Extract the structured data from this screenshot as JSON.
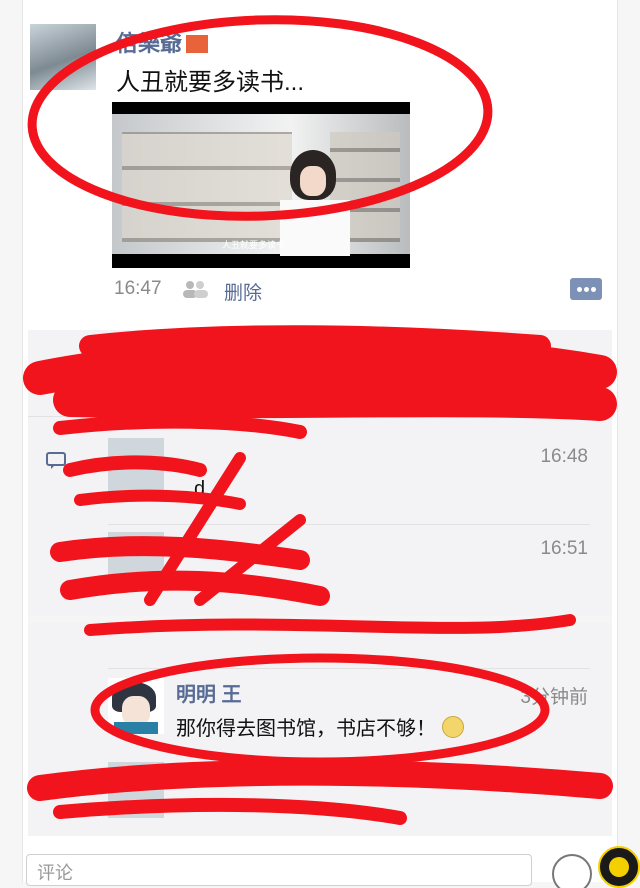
{
  "post": {
    "author": "倍樂爺",
    "text": "人丑就要多读书...",
    "time": "16:47",
    "delete_label": "删除",
    "video_subtitle": "人丑就要多读书"
  },
  "comments": [
    {
      "name": "",
      "text": "d",
      "time": "16:48"
    },
    {
      "name": "",
      "text": "",
      "time": "16:51"
    },
    {
      "name": "明明 王",
      "text": "那你得去图书馆，书店不够！",
      "time": "3分钟前"
    }
  ],
  "comment_input": {
    "placeholder": "评论"
  },
  "icons": [
    "people-icon",
    "more-icon",
    "comment-bubble-icon",
    "smiley-icon"
  ],
  "colors": {
    "link": "#576b95",
    "scribble": "#f2141c"
  }
}
